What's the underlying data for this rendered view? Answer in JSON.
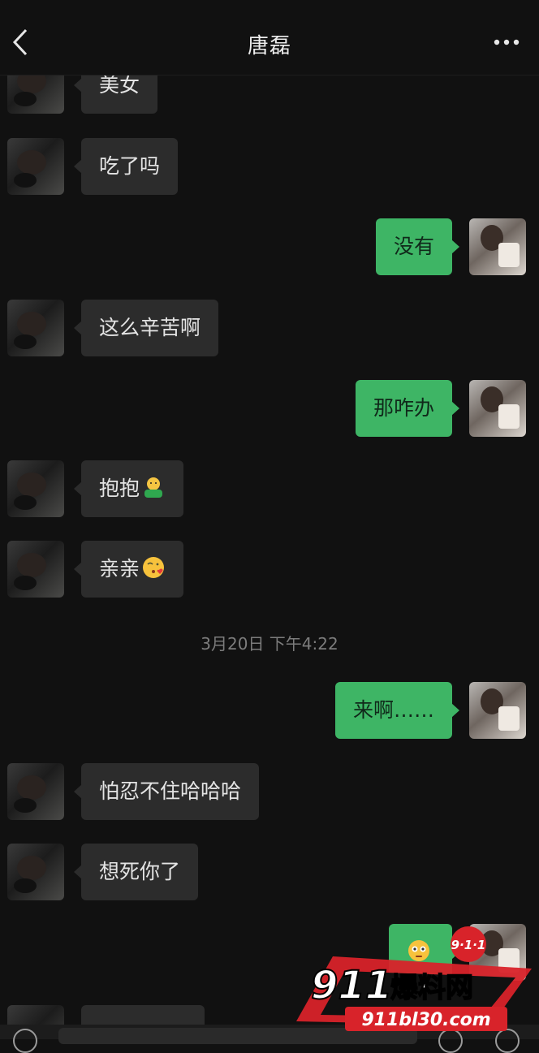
{
  "header": {
    "title": "唐磊"
  },
  "icons": {
    "back": "chevron-left-icon",
    "more": "more-dots-icon"
  },
  "messages": [
    {
      "side": "in",
      "text": "美女"
    },
    {
      "side": "in",
      "text": "吃了吗"
    },
    {
      "side": "out",
      "text": "没有"
    },
    {
      "side": "in",
      "text": "这么辛苦啊"
    },
    {
      "side": "out",
      "text": "那咋办"
    },
    {
      "side": "in",
      "text": "抱抱",
      "emoji": "hug-emoji"
    },
    {
      "side": "in",
      "text": "亲亲",
      "emoji": "kiss-emoji"
    },
    {
      "side": "out",
      "text": "来啊……"
    },
    {
      "side": "in",
      "text": "怕忍不住哈哈哈"
    },
    {
      "side": "in",
      "text": "想死你了"
    },
    {
      "side": "out",
      "emoji": "flushed-emoji"
    }
  ],
  "timestamp": "3月20日 下午4:22",
  "watermark": {
    "badge": "9·1·1",
    "main_number": "911",
    "main_text": "爆料网",
    "url": "911bl30.com"
  },
  "colors": {
    "background": "#111111",
    "incoming_bubble": "#2c2c2c",
    "outgoing_bubble": "#3eb565",
    "watermark_red": "#d8232a"
  }
}
